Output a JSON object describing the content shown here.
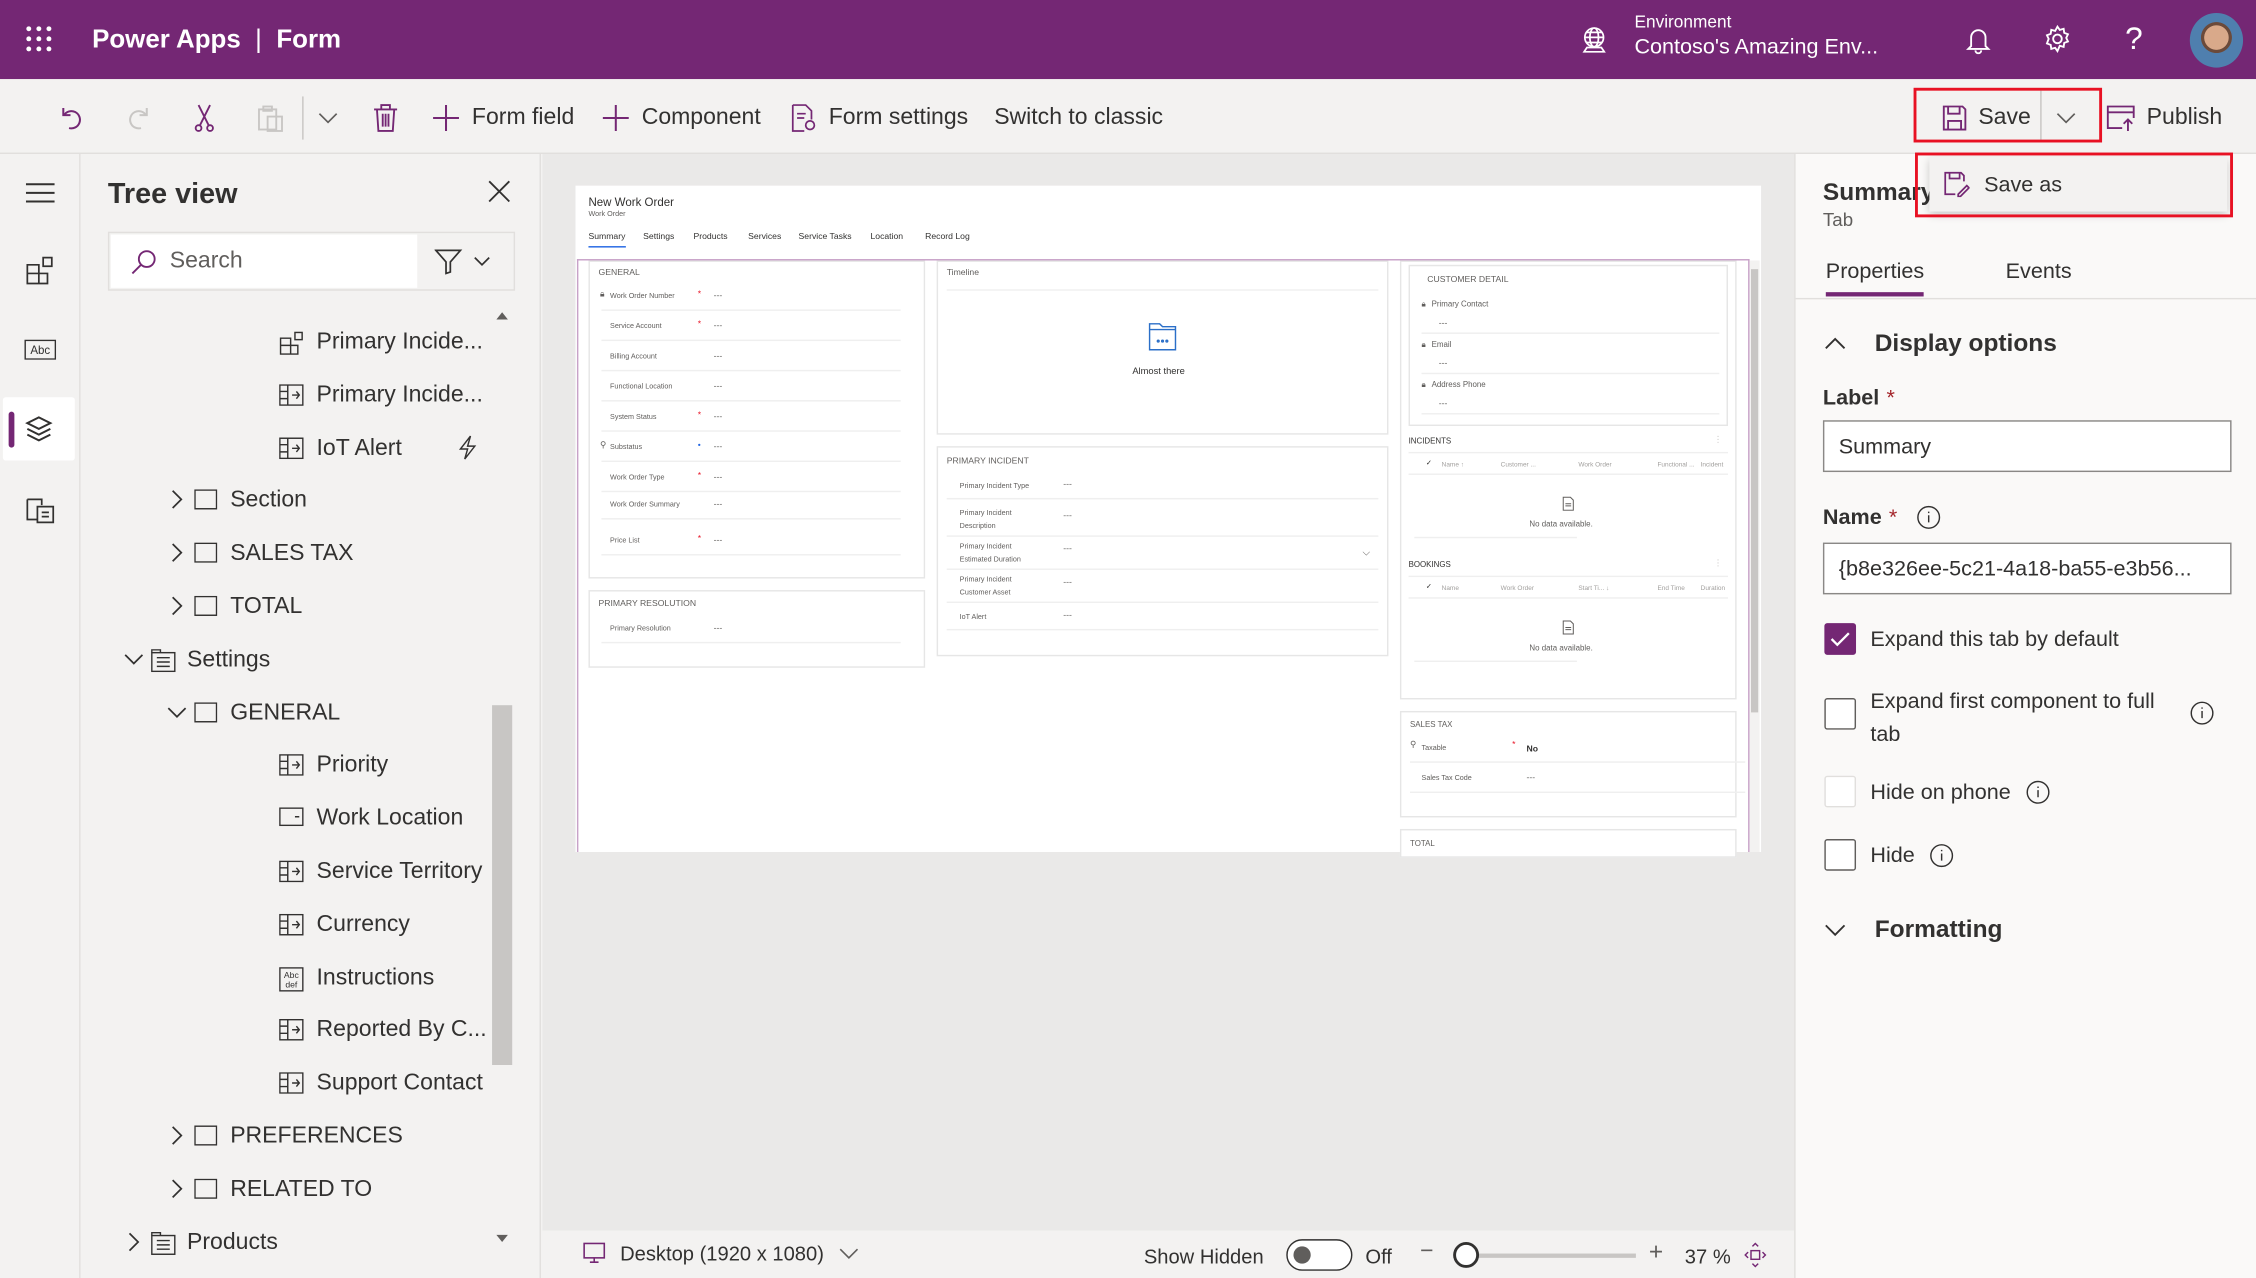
{
  "app": {
    "name": "Power Apps",
    "separator": "|",
    "section": "Form"
  },
  "environment": {
    "label": "Environment",
    "name": "Contoso's Amazing Env..."
  },
  "header_icons": [
    "waffle-icon",
    "globe-icon",
    "bell-icon",
    "gear-icon",
    "help-icon",
    "avatar"
  ],
  "toolbar": {
    "form_field": "Form field",
    "component": "Component",
    "form_settings": "Form settings",
    "switch_classic": "Switch to classic",
    "save": "Save",
    "publish": "Publish",
    "save_as": "Save as"
  },
  "tree": {
    "title": "Tree view",
    "search_placeholder": "Search",
    "items": [
      {
        "label": "Primary Incide...",
        "level": 3,
        "icon": "subgrid-icon"
      },
      {
        "label": "Primary Incide...",
        "level": 3,
        "icon": "field-icon"
      },
      {
        "label": "IoT Alert",
        "level": 3,
        "icon": "field-icon",
        "badge": "lightning-icon"
      },
      {
        "label": "Section",
        "level": 2,
        "icon": "section-icon",
        "chevron": "right"
      },
      {
        "label": "SALES TAX",
        "level": 2,
        "icon": "section-icon",
        "chevron": "right"
      },
      {
        "label": "TOTAL",
        "level": 2,
        "icon": "section-icon",
        "chevron": "right"
      },
      {
        "label": "Settings",
        "level": 1,
        "icon": "tab-icon",
        "chevron": "down"
      },
      {
        "label": "GENERAL",
        "level": 2,
        "icon": "section-icon",
        "chevron": "down"
      },
      {
        "label": "Priority",
        "level": 3,
        "icon": "field-icon"
      },
      {
        "label": "Work Location",
        "level": 3,
        "icon": "option-icon"
      },
      {
        "label": "Service Territory",
        "level": 3,
        "icon": "field-icon"
      },
      {
        "label": "Currency",
        "level": 3,
        "icon": "field-icon"
      },
      {
        "label": "Instructions",
        "level": 3,
        "icon": "text-icon"
      },
      {
        "label": "Reported By C...",
        "level": 3,
        "icon": "field-icon"
      },
      {
        "label": "Support Contact",
        "level": 3,
        "icon": "field-icon"
      },
      {
        "label": "PREFERENCES",
        "level": 2,
        "icon": "section-icon",
        "chevron": "right"
      },
      {
        "label": "RELATED TO",
        "level": 2,
        "icon": "section-icon",
        "chevron": "right"
      },
      {
        "label": "Products",
        "level": 1,
        "icon": "tab-icon",
        "chevron": "right"
      }
    ]
  },
  "form": {
    "title": "New Work Order",
    "entity": "Work Order",
    "tabs": [
      "Summary",
      "Settings",
      "Products",
      "Services",
      "Service Tasks",
      "Location",
      "Record Log"
    ],
    "general": {
      "title": "GENERAL",
      "fields": [
        {
          "label": "Work Order Number",
          "req": "*",
          "value": "---",
          "icon": "lock"
        },
        {
          "label": "Service Account",
          "req": "*",
          "value": "---"
        },
        {
          "label": "Billing Account",
          "value": "---"
        },
        {
          "label": "Functional Location",
          "value": "---"
        },
        {
          "label": "System Status",
          "req": "*",
          "value": "---"
        },
        {
          "label": "Substatus",
          "req": "•",
          "value": "---",
          "icon": "search"
        },
        {
          "label": "Work Order Type",
          "req": "*",
          "value": "---"
        },
        {
          "label": "Work Order Summary",
          "value": "---"
        },
        {
          "label": "Price List",
          "req": "*",
          "value": "---"
        }
      ]
    },
    "primary_resolution": {
      "title": "PRIMARY RESOLUTION",
      "fields": [
        {
          "label": "Primary Resolution",
          "value": "---"
        }
      ]
    },
    "timeline": {
      "title": "Timeline",
      "message": "Almost there"
    },
    "primary_incident": {
      "title": "PRIMARY INCIDENT",
      "fields": [
        {
          "label": "Primary Incident Type",
          "value": "---"
        },
        {
          "label": "Primary Incident\nDescription",
          "value": "---"
        },
        {
          "label": "Primary Incident\nEstimated Duration",
          "value": "---"
        },
        {
          "label": "Primary Incident\nCustomer Asset",
          "value": "---"
        },
        {
          "label": "IoT Alert",
          "value": "---"
        }
      ]
    },
    "customer_detail": {
      "title": "CUSTOMER DETAIL",
      "fields": [
        {
          "label": "Primary Contact",
          "value": "---"
        },
        {
          "label": "Email",
          "value": "---"
        },
        {
          "label": "Address Phone",
          "value": "---"
        }
      ]
    },
    "incidents": {
      "title": "INCIDENTS",
      "columns": [
        "Name ↑",
        "Customer ...",
        "Work Order",
        "Functional ...",
        "Incident"
      ],
      "empty": "No data available."
    },
    "bookings": {
      "title": "BOOKINGS",
      "columns": [
        "Name",
        "Work Order",
        "Start Ti... ↓",
        "End Time",
        "Duration"
      ],
      "empty": "No data available."
    },
    "sales_tax": {
      "title": "SALES TAX",
      "fields": [
        {
          "label": "Taxable",
          "req": "*",
          "value": "No"
        },
        {
          "label": "Sales Tax Code",
          "value": "---"
        }
      ]
    },
    "total": {
      "title": "TOTAL"
    }
  },
  "bottom": {
    "device": "Desktop (1920 x 1080)",
    "show_hidden": "Show Hidden",
    "toggle_state": "Off",
    "zoom": "37 %",
    "zoom_percent": 37
  },
  "properties": {
    "title": "Summary",
    "subtitle": "Tab",
    "tabs": [
      "Properties",
      "Events"
    ],
    "display_options": "Display options",
    "label_label": "Label",
    "label_value": "Summary",
    "name_label": "Name",
    "name_value": "{b8e326ee-5c21-4a18-ba55-e3b56...",
    "required_mark": "*",
    "expand_tab": {
      "label": "Expand this tab by default",
      "checked": true
    },
    "expand_first": {
      "label": "Expand first component to full tab",
      "checked": false
    },
    "hide_phone": {
      "label": "Hide on phone",
      "checked": false
    },
    "hide": {
      "label": "Hide",
      "checked": false
    },
    "formatting": "Formatting"
  },
  "colors": {
    "brand": "#742774",
    "accent": "#742774",
    "highlight": "#e81123"
  }
}
